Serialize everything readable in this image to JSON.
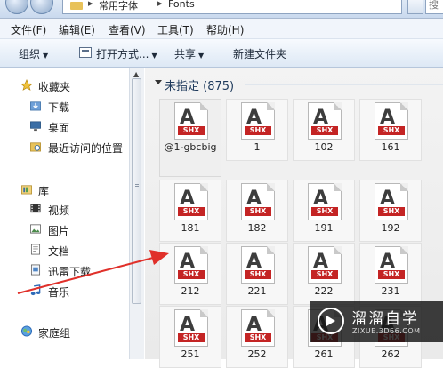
{
  "address": {
    "crumbs": [
      "常用字体",
      "Fonts"
    ],
    "separator": "▸",
    "search_placeholder": "搜"
  },
  "menu": {
    "items": [
      "文件(F)",
      "编辑(E)",
      "查看(V)",
      "工具(T)",
      "帮助(H)"
    ]
  },
  "toolbar": {
    "organize_label": "组织",
    "open_with_label": "打开方式...",
    "share_label": "共享",
    "new_folder_label": "新建文件夹",
    "dropdown_arrow": "▼"
  },
  "nav": {
    "favorites_label": "收藏夹",
    "downloads_label": "下载",
    "desktop_label": "桌面",
    "recent_label": "最近访问的位置",
    "libraries_label": "库",
    "videos_label": "视频",
    "pictures_label": "图片",
    "documents_label": "文档",
    "thunder_label": "迅雷下载",
    "music_label": "音乐",
    "homegroup_label": "家庭组"
  },
  "content": {
    "group_title": "未指定 (875)",
    "file_badge": "SHX",
    "file_glyph": "A",
    "files": [
      "@1-gbcbig",
      "1",
      "102",
      "161",
      "181",
      "182",
      "191",
      "192",
      "212",
      "221",
      "222",
      "231",
      "251",
      "252",
      "261",
      "262"
    ]
  },
  "watermark": {
    "title": "溜溜自学",
    "url": "ZIXUE.3D66.COM"
  },
  "colors": {
    "shx_red": "#c42424",
    "arrow_red": "#e0302a",
    "group_title": "#1e3a5c"
  }
}
